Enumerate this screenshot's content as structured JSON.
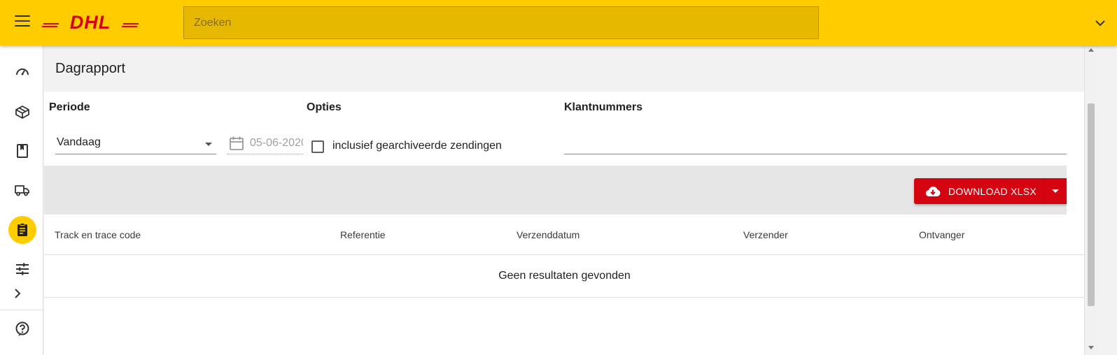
{
  "colors": {
    "brand_yellow": "#ffcc00",
    "brand_red": "#d40511",
    "search_bg": "#e6b800"
  },
  "header": {
    "logo_text": "DHL",
    "search_placeholder": "Zoeken"
  },
  "sidebar": {
    "items": [
      {
        "name": "dashboard",
        "icon": "speedometer-icon",
        "active": false
      },
      {
        "name": "shipments",
        "icon": "package-icon",
        "active": false
      },
      {
        "name": "addressbook",
        "icon": "book-icon",
        "active": false
      },
      {
        "name": "pickups",
        "icon": "truck-icon",
        "active": false
      },
      {
        "name": "reports",
        "icon": "clipboard-icon",
        "active": true
      },
      {
        "name": "settings",
        "icon": "sliders-icon",
        "active": false
      }
    ],
    "help_icon": "help-icon"
  },
  "page": {
    "title": "Dagrapport"
  },
  "filters": {
    "period_label": "Periode",
    "period_value": "Vandaag",
    "date_value": "05-06-2020",
    "options_label": "Opties",
    "archived_label": "inclusief gearchiveerde zendingen",
    "archived_checked": false,
    "customer_label": "Klantnummers",
    "customer_value": ""
  },
  "toolbar": {
    "download_label": "DOWNLOAD XLSX"
  },
  "table": {
    "columns": [
      "Track en trace code",
      "Referentie",
      "Verzenddatum",
      "Verzender",
      "Ontvanger"
    ],
    "empty_text": "Geen resultaten gevonden"
  }
}
